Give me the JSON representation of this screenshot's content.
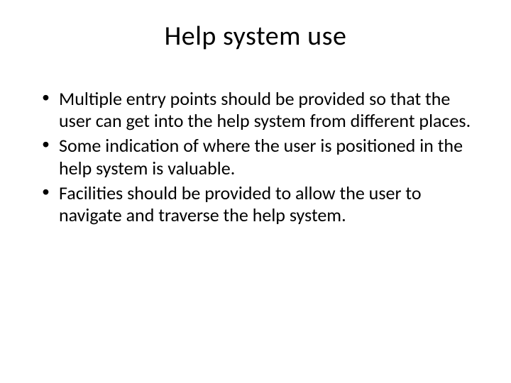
{
  "slide": {
    "title": "Help system use",
    "bullets": [
      "Multiple entry points should be provided so that the user can get into the help system from different places.",
      "Some indication of where the user is positioned in the help system is valuable.",
      "Facilities should be provided to allow the user to navigate and traverse the help system."
    ]
  }
}
